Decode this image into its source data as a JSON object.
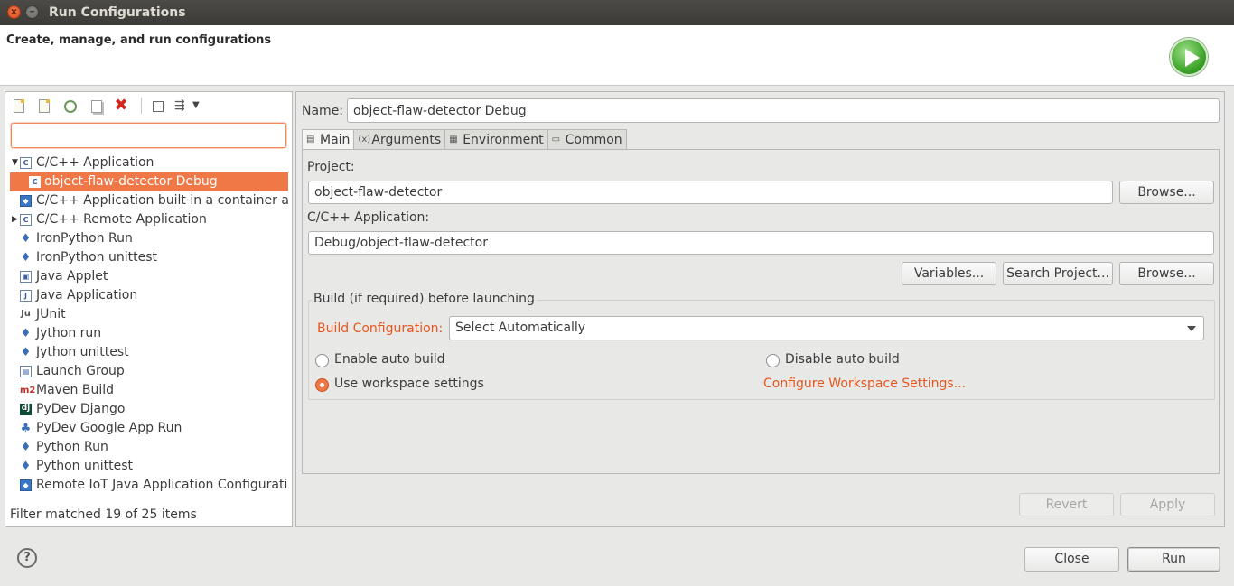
{
  "window": {
    "title": "Run Configurations"
  },
  "header": {
    "description": "Create, manage, and run configurations"
  },
  "toolbar": {
    "icons": [
      "new-launch-config-icon",
      "new-prototype-icon",
      "export-icon",
      "duplicate-icon",
      "delete-icon",
      "collapse-all-icon",
      "filter-icon",
      "view-menu-icon"
    ]
  },
  "filter": {
    "value": ""
  },
  "tree": {
    "items": [
      {
        "label": "C/C++ Application",
        "expanded": true
      },
      {
        "label": "object-flaw-detector Debug",
        "selected": true
      },
      {
        "label": "C/C++ Application built in a container and"
      },
      {
        "label": "C/C++ Remote Application",
        "expanded": false
      },
      {
        "label": "IronPython Run"
      },
      {
        "label": "IronPython unittest"
      },
      {
        "label": "Java Applet"
      },
      {
        "label": "Java Application"
      },
      {
        "label": "JUnit"
      },
      {
        "label": "Jython run"
      },
      {
        "label": "Jython unittest"
      },
      {
        "label": "Launch Group"
      },
      {
        "label": "Maven Build"
      },
      {
        "label": "PyDev Django"
      },
      {
        "label": "PyDev Google App Run"
      },
      {
        "label": "Python Run"
      },
      {
        "label": "Python unittest"
      },
      {
        "label": "Remote IoT Java Application Configuratio"
      }
    ],
    "status": "Filter matched 19 of 25 items"
  },
  "config": {
    "name_label": "Name:",
    "name_value": "object-flaw-detector Debug",
    "tabs": [
      {
        "label": "Main",
        "active": true
      },
      {
        "label": "Arguments"
      },
      {
        "label": "Environment"
      },
      {
        "label": "Common"
      }
    ],
    "main": {
      "project_label": "Project:",
      "project_value": "object-flaw-detector",
      "browse_label": "Browse...",
      "app_label": "C/C++ Application:",
      "app_value": "Debug/object-flaw-detector",
      "variables_label": "Variables...",
      "search_project_label": "Search Project...",
      "browse2_label": "Browse...",
      "build_group_title": "Build (if required) before launching",
      "build_config_label": "Build Configuration:",
      "build_config_value": "Select Automatically",
      "enable_auto_build": "Enable auto build",
      "disable_auto_build": "Disable auto build",
      "use_workspace": "Use workspace settings",
      "configure_workspace": "Configure Workspace Settings..."
    },
    "revert_label": "Revert",
    "apply_label": "Apply"
  },
  "footer": {
    "help_label": "?",
    "close_label": "Close",
    "run_label": "Run"
  },
  "colors": {
    "accent": "#f07746",
    "link": "#e6561f",
    "run_green": "#3aa126"
  }
}
